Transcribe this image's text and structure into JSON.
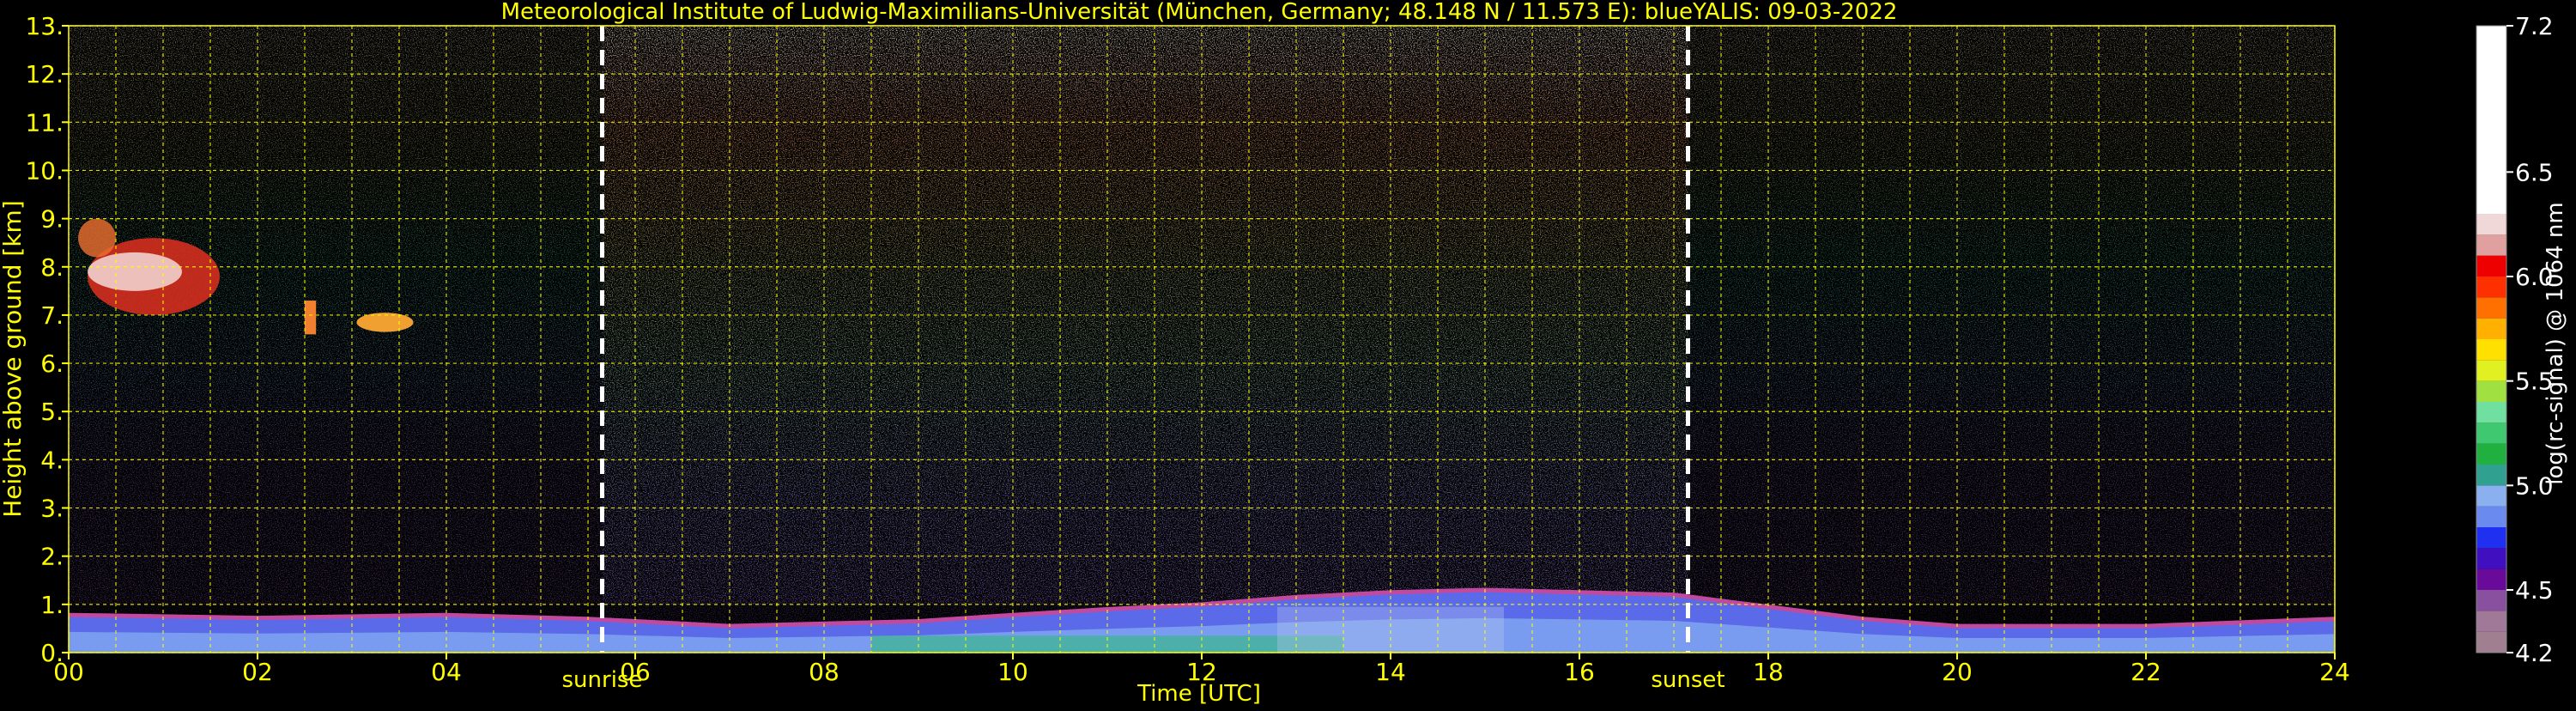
{
  "chart_data": {
    "type": "heatmap",
    "title": "Meteorological Institute of Ludwig-Maximilians-Universität (München, Germany; 48.148 N / 11.573 E):    blueYALIS: 09-03-2022",
    "xlabel": "Time [UTC]",
    "ylabel": "Height above ground [km]",
    "xlim": [
      0,
      24
    ],
    "ylim": [
      0,
      13
    ],
    "x_ticks": [
      "00",
      "02",
      "04",
      "06",
      "08",
      "10",
      "12",
      "14",
      "16",
      "18",
      "20",
      "22",
      "24"
    ],
    "y_ticks": [
      "0.",
      "1.",
      "2.",
      "3.",
      "4.",
      "5.",
      "6.",
      "7.",
      "8.",
      "9.",
      "10.",
      "11.",
      "12.",
      "13."
    ],
    "grid": true,
    "annotations": [
      {
        "text": "sunrise",
        "x": 5.65
      },
      {
        "text": "sunset",
        "x": 17.15
      }
    ],
    "colorbar": {
      "label": "log(rc-signal) @ 1064 nm",
      "range": [
        4.2,
        7.2
      ],
      "tick_labels": [
        "4.2",
        "4.5",
        "5.0",
        "5.5",
        "6.0",
        "6.5",
        "7.2"
      ],
      "tick_values": [
        4.2,
        4.5,
        5.0,
        5.5,
        6.0,
        6.5,
        7.2
      ]
    },
    "colors": {
      "text": "#ffff00",
      "grid": "#ffff00",
      "background": "#000000",
      "sun_lines": "#ffffff",
      "colorbar_label": "#ffffff"
    }
  }
}
